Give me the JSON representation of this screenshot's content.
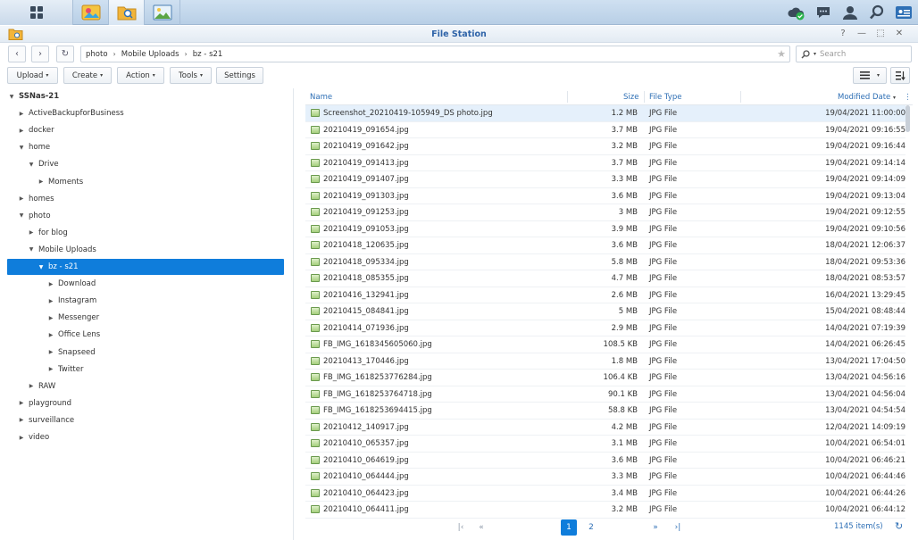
{
  "window": {
    "title": "File Station",
    "controls": [
      "?",
      "—",
      "⬚",
      "✕"
    ]
  },
  "colors": {
    "accent": "#0f7ddb",
    "header_text": "#2e6fb5",
    "title_text": "#2e63a8"
  },
  "address": {
    "breadcrumbs": [
      "photo",
      "Mobile Uploads",
      "bz - s21"
    ],
    "search_placeholder": "Search"
  },
  "toolbar": {
    "upload": "Upload",
    "create": "Create",
    "action": "Action",
    "tools": "Tools",
    "settings": "Settings"
  },
  "tree": [
    {
      "label": "SSNas-21",
      "level": 0,
      "expanded": true
    },
    {
      "label": "ActiveBackupforBusiness",
      "level": 1,
      "expanded": false
    },
    {
      "label": "docker",
      "level": 1,
      "expanded": false
    },
    {
      "label": "home",
      "level": 1,
      "expanded": true
    },
    {
      "label": "Drive",
      "level": 2,
      "expanded": true
    },
    {
      "label": "Moments",
      "level": 3,
      "expanded": false
    },
    {
      "label": "homes",
      "level": 1,
      "expanded": false
    },
    {
      "label": "photo",
      "level": 1,
      "expanded": true
    },
    {
      "label": "for blog",
      "level": 2,
      "expanded": false
    },
    {
      "label": "Mobile Uploads",
      "level": 2,
      "expanded": true
    },
    {
      "label": "bz - s21",
      "level": 3,
      "expanded": true,
      "selected": true
    },
    {
      "label": "Download",
      "level": 4,
      "expanded": false
    },
    {
      "label": "Instagram",
      "level": 4,
      "expanded": false
    },
    {
      "label": "Messenger",
      "level": 4,
      "expanded": false
    },
    {
      "label": "Office Lens",
      "level": 4,
      "expanded": false
    },
    {
      "label": "Snapseed",
      "level": 4,
      "expanded": false
    },
    {
      "label": "Twitter",
      "level": 4,
      "expanded": false
    },
    {
      "label": "RAW",
      "level": 2,
      "expanded": false
    },
    {
      "label": "playground",
      "level": 1,
      "expanded": false
    },
    {
      "label": "surveillance",
      "level": 1,
      "expanded": false
    },
    {
      "label": "video",
      "level": 1,
      "expanded": false
    }
  ],
  "columns": {
    "name": "Name",
    "size": "Size",
    "type": "File Type",
    "modified": "Modified Date"
  },
  "files": [
    {
      "name": "Screenshot_20210419-105949_DS photo.jpg",
      "size": "1.2 MB",
      "type": "JPG File",
      "modified": "19/04/2021 11:00:00",
      "selected": true
    },
    {
      "name": "20210419_091654.jpg",
      "size": "3.7 MB",
      "type": "JPG File",
      "modified": "19/04/2021 09:16:55"
    },
    {
      "name": "20210419_091642.jpg",
      "size": "3.2 MB",
      "type": "JPG File",
      "modified": "19/04/2021 09:16:44"
    },
    {
      "name": "20210419_091413.jpg",
      "size": "3.7 MB",
      "type": "JPG File",
      "modified": "19/04/2021 09:14:14"
    },
    {
      "name": "20210419_091407.jpg",
      "size": "3.3 MB",
      "type": "JPG File",
      "modified": "19/04/2021 09:14:09"
    },
    {
      "name": "20210419_091303.jpg",
      "size": "3.6 MB",
      "type": "JPG File",
      "modified": "19/04/2021 09:13:04"
    },
    {
      "name": "20210419_091253.jpg",
      "size": "3 MB",
      "type": "JPG File",
      "modified": "19/04/2021 09:12:55"
    },
    {
      "name": "20210419_091053.jpg",
      "size": "3.9 MB",
      "type": "JPG File",
      "modified": "19/04/2021 09:10:56"
    },
    {
      "name": "20210418_120635.jpg",
      "size": "3.6 MB",
      "type": "JPG File",
      "modified": "18/04/2021 12:06:37"
    },
    {
      "name": "20210418_095334.jpg",
      "size": "5.8 MB",
      "type": "JPG File",
      "modified": "18/04/2021 09:53:36"
    },
    {
      "name": "20210418_085355.jpg",
      "size": "4.7 MB",
      "type": "JPG File",
      "modified": "18/04/2021 08:53:57"
    },
    {
      "name": "20210416_132941.jpg",
      "size": "2.6 MB",
      "type": "JPG File",
      "modified": "16/04/2021 13:29:45"
    },
    {
      "name": "20210415_084841.jpg",
      "size": "5 MB",
      "type": "JPG File",
      "modified": "15/04/2021 08:48:44"
    },
    {
      "name": "20210414_071936.jpg",
      "size": "2.9 MB",
      "type": "JPG File",
      "modified": "14/04/2021 07:19:39"
    },
    {
      "name": "FB_IMG_1618345605060.jpg",
      "size": "108.5 KB",
      "type": "JPG File",
      "modified": "14/04/2021 06:26:45"
    },
    {
      "name": "20210413_170446.jpg",
      "size": "1.8 MB",
      "type": "JPG File",
      "modified": "13/04/2021 17:04:50"
    },
    {
      "name": "FB_IMG_1618253776284.jpg",
      "size": "106.4 KB",
      "type": "JPG File",
      "modified": "13/04/2021 04:56:16"
    },
    {
      "name": "FB_IMG_1618253764718.jpg",
      "size": "90.1 KB",
      "type": "JPG File",
      "modified": "13/04/2021 04:56:04"
    },
    {
      "name": "FB_IMG_1618253694415.jpg",
      "size": "58.8 KB",
      "type": "JPG File",
      "modified": "13/04/2021 04:54:54"
    },
    {
      "name": "20210412_140917.jpg",
      "size": "4.2 MB",
      "type": "JPG File",
      "modified": "12/04/2021 14:09:19"
    },
    {
      "name": "20210410_065357.jpg",
      "size": "3.1 MB",
      "type": "JPG File",
      "modified": "10/04/2021 06:54:01"
    },
    {
      "name": "20210410_064619.jpg",
      "size": "3.6 MB",
      "type": "JPG File",
      "modified": "10/04/2021 06:46:21"
    },
    {
      "name": "20210410_064444.jpg",
      "size": "3.3 MB",
      "type": "JPG File",
      "modified": "10/04/2021 06:44:46"
    },
    {
      "name": "20210410_064423.jpg",
      "size": "3.4 MB",
      "type": "JPG File",
      "modified": "10/04/2021 06:44:26"
    },
    {
      "name": "20210410_064411.jpg",
      "size": "3.2 MB",
      "type": "JPG File",
      "modified": "10/04/2021 06:44:12"
    }
  ],
  "pager": {
    "pages": [
      "1",
      "2"
    ],
    "current": "1",
    "item_count": "1145 item(s)"
  }
}
